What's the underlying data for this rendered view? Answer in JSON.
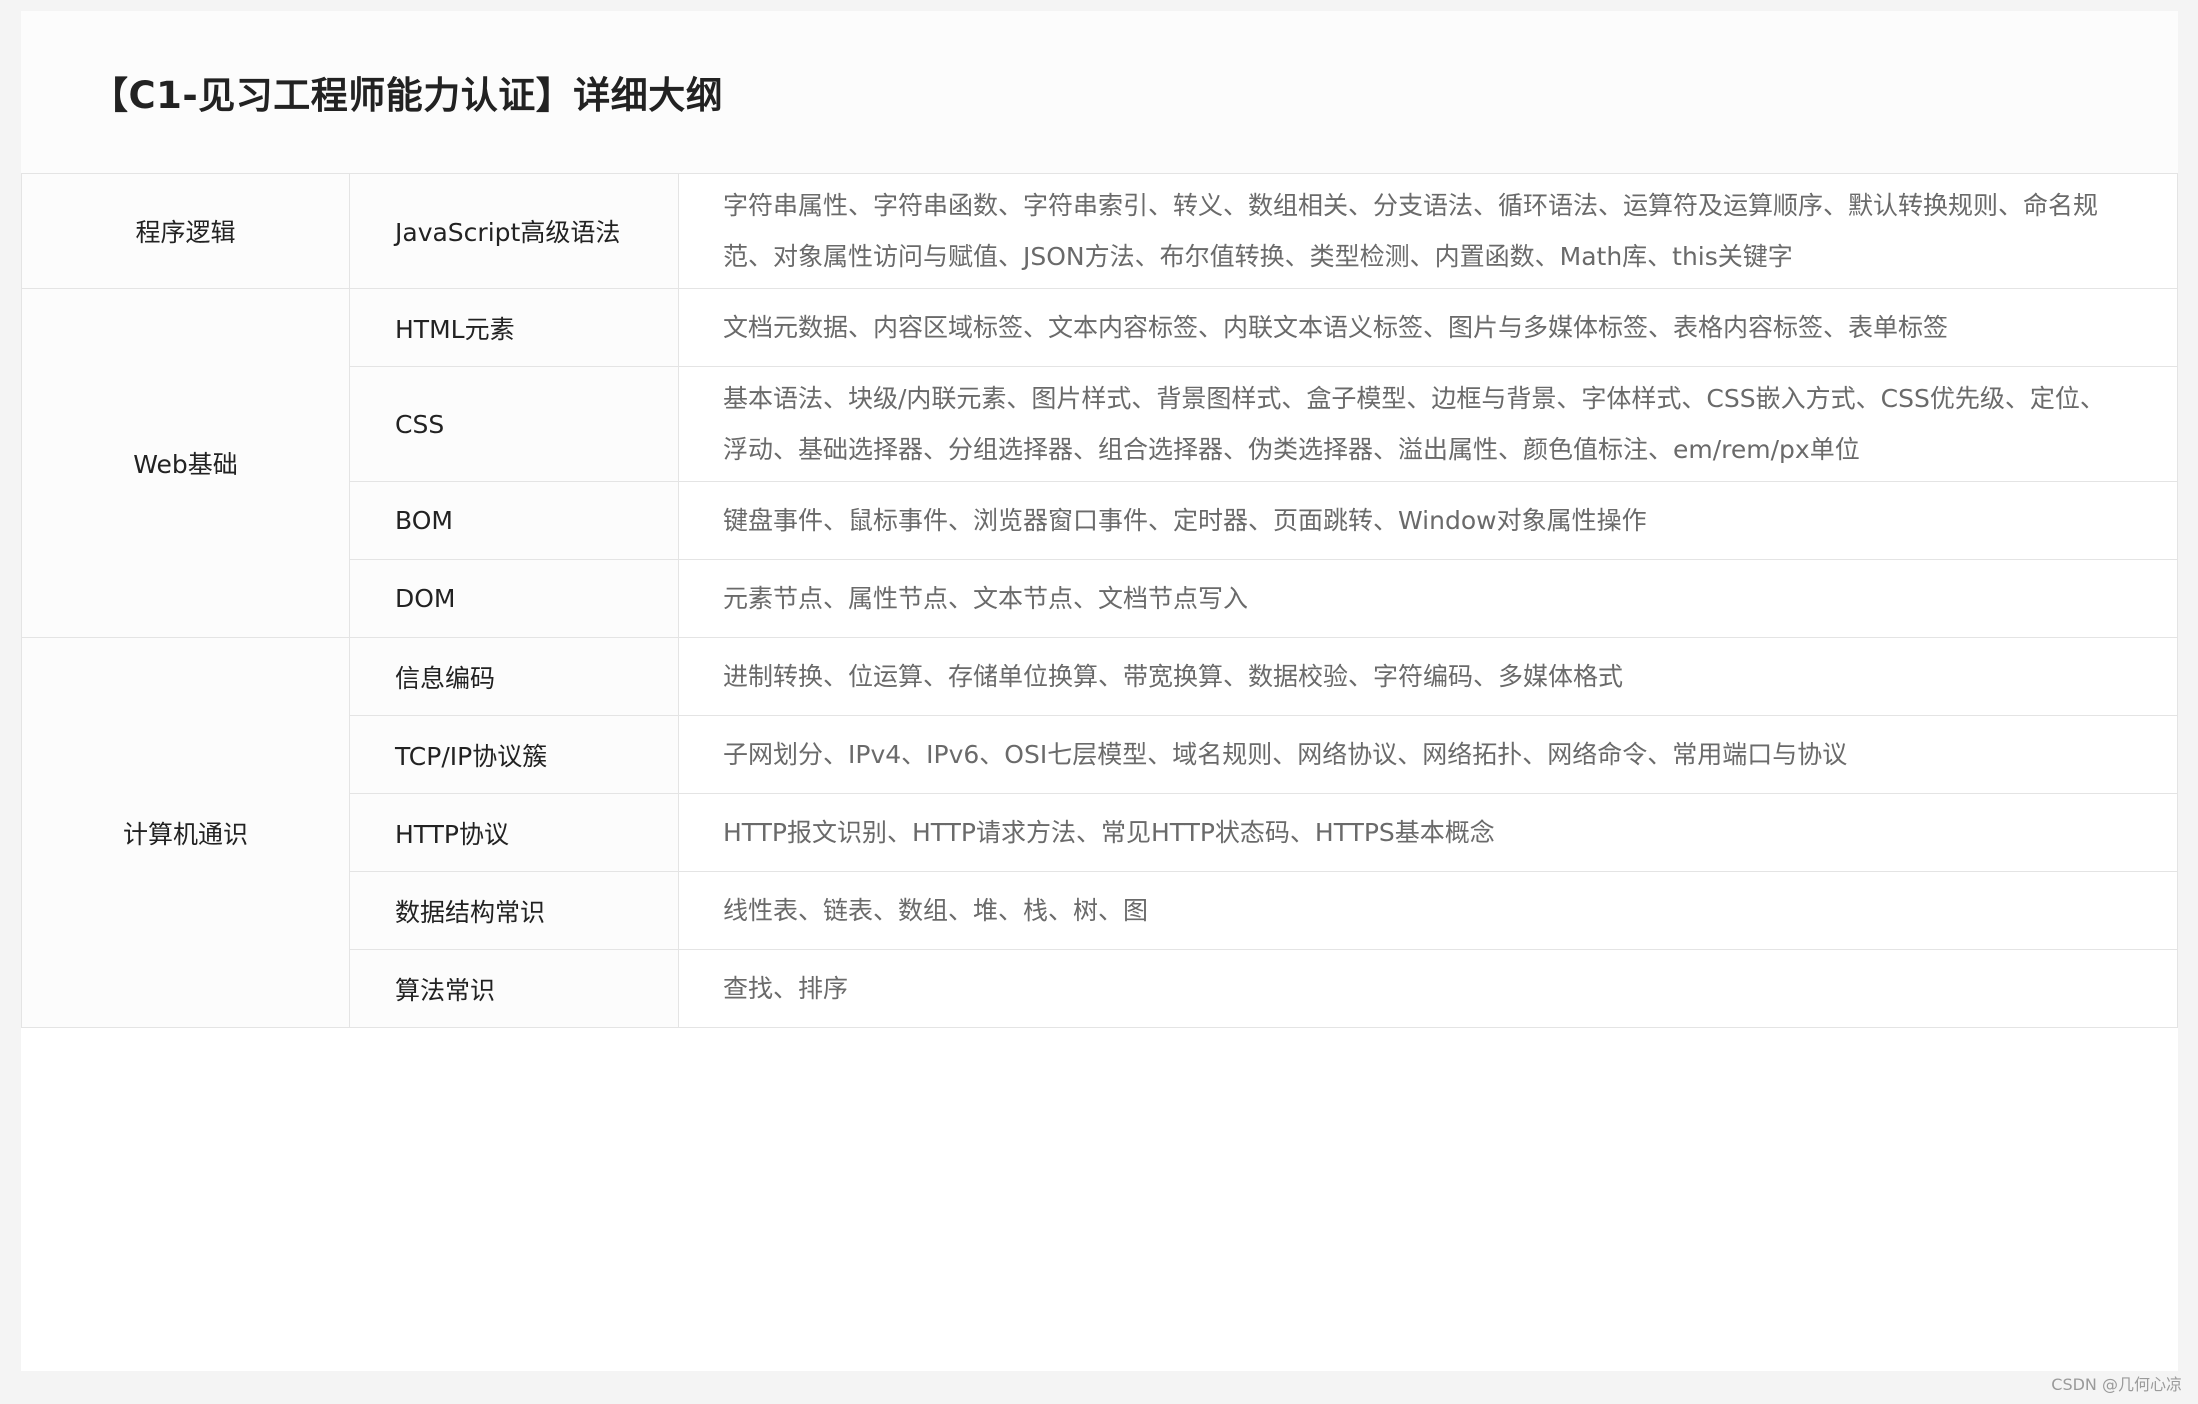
{
  "title": "【C1-见习工程师能力认证】详细大纲",
  "sections": [
    {
      "category": "程序逻辑",
      "rows": [
        {
          "topic": "JavaScript高级语法",
          "content": "字符串属性、字符串函数、字符串索引、转义、数组相关、分支语法、循环语法、运算符及运算顺序、默认转换规则、命名规范、对象属性访问与赋值、JSON方法、布尔值转换、类型检测、内置函数、Math库、this关键字"
        }
      ]
    },
    {
      "category": "Web基础",
      "rows": [
        {
          "topic": "HTML元素",
          "content": "文档元数据、内容区域标签、文本内容标签、内联文本语义标签、图片与多媒体标签、表格内容标签、表单标签"
        },
        {
          "topic": "CSS",
          "content": "基本语法、块级/内联元素、图片样式、背景图样式、盒子模型、边框与背景、字体样式、CSS嵌入方式、CSS优先级、定位、浮动、基础选择器、分组选择器、组合选择器、伪类选择器、溢出属性、颜色值标注、em/rem/px单位"
        },
        {
          "topic": "BOM",
          "content": "键盘事件、鼠标事件、浏览器窗口事件、定时器、页面跳转、Window对象属性操作"
        },
        {
          "topic": "DOM",
          "content": "元素节点、属性节点、文本节点、文档节点写入"
        }
      ]
    },
    {
      "category": "计算机通识",
      "rows": [
        {
          "topic": "信息编码",
          "content": "进制转换、位运算、存储单位换算、带宽换算、数据校验、字符编码、多媒体格式"
        },
        {
          "topic": "TCP/IP协议簇",
          "content": "子网划分、IPv4、IPv6、OSI七层模型、域名规则、网络协议、网络拓扑、网络命令、常用端口与协议"
        },
        {
          "topic": "HTTP协议",
          "content": "HTTP报文识别、HTTP请求方法、常见HTTP状态码、HTTPS基本概念"
        },
        {
          "topic": "数据结构常识",
          "content": "线性表、链表、数组、堆、栈、树、图"
        },
        {
          "topic": "算法常识",
          "content": "查找、排序"
        }
      ]
    }
  ],
  "watermark": "CSDN @几何心凉"
}
